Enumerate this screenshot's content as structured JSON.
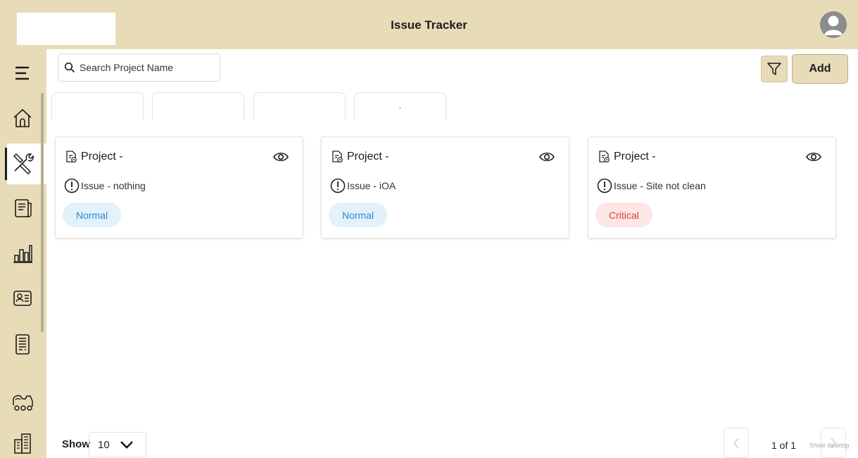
{
  "header": {
    "title": "Issue Tracker"
  },
  "sidebar": {
    "items": [
      {
        "icon": "menu-icon"
      },
      {
        "icon": "home-icon"
      },
      {
        "icon": "tools-icon",
        "active": true
      },
      {
        "icon": "document-icon"
      },
      {
        "icon": "bar-chart-icon"
      },
      {
        "icon": "contact-card-icon"
      },
      {
        "icon": "report-icon"
      },
      {
        "icon": "vehicle-icon"
      },
      {
        "icon": "buildings-icon"
      }
    ]
  },
  "toolbar": {
    "search_placeholder": "Search Project Name",
    "add_label": "Add"
  },
  "chips": [
    "",
    "",
    "",
    "-"
  ],
  "cards": [
    {
      "project_label": "Project -",
      "issue_label": "Issue - nothing",
      "priority": "Normal"
    },
    {
      "project_label": "Project -",
      "issue_label": "Issue - iOA",
      "priority": "Normal"
    },
    {
      "project_label": "Project -",
      "issue_label": "Issue - Site not clean",
      "priority": "Critical"
    }
  ],
  "footer": {
    "show_label": "Show",
    "page_size": "10",
    "page_info": "1 of 1",
    "overlay_text": "Show desktop"
  },
  "colors": {
    "brand": "#e8dcb8",
    "normal_text": "#2a8ad0",
    "normal_bg": "#e3f1fb",
    "critical_text": "#d9413d",
    "critical_bg": "#fde6e6"
  }
}
